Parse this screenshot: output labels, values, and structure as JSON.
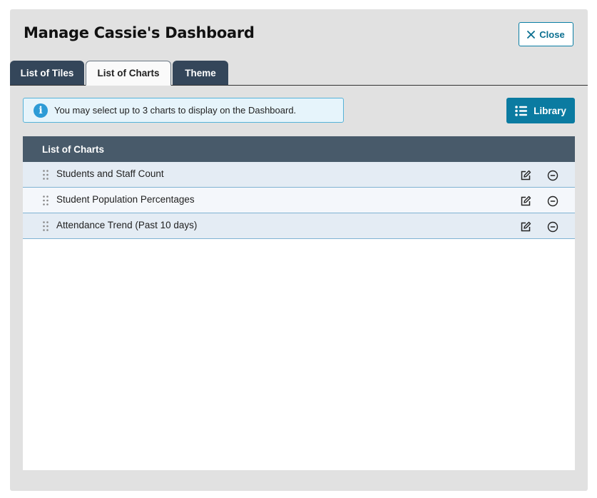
{
  "modal": {
    "title": "Manage Cassie's Dashboard",
    "close_label": "Close"
  },
  "tabs": [
    {
      "label": "List of Tiles",
      "active": false
    },
    {
      "label": "List of Charts",
      "active": true
    },
    {
      "label": "Theme",
      "active": false
    }
  ],
  "info": {
    "icon": "info-icon",
    "message": "You may select up to 3 charts to display on the Dashboard."
  },
  "library": {
    "icon": "list-icon",
    "label": "Library"
  },
  "charts_panel": {
    "header": "List of Charts",
    "rows": [
      {
        "label": "Students and Staff Count"
      },
      {
        "label": "Student Population Percentages"
      },
      {
        "label": "Attendance Trend (Past 10 days)"
      }
    ]
  },
  "colors": {
    "accent": "#0b7ba1",
    "tab_dark": "#34465a",
    "header_bg": "#485a6a",
    "info_bg": "#e6f4fb",
    "info_icon": "#2d9bd6"
  }
}
